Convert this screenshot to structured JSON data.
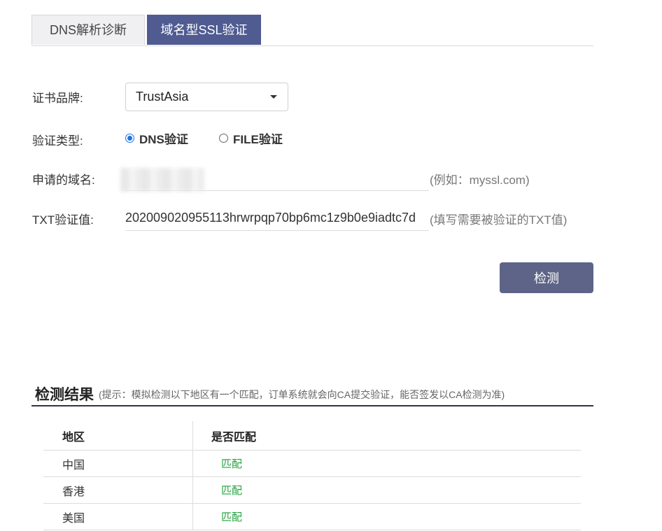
{
  "tabs": [
    {
      "label": "DNS解析诊断",
      "active": false
    },
    {
      "label": "域名型SSL验证",
      "active": true
    }
  ],
  "form": {
    "brand_label": "证书品牌:",
    "brand_value": "TrustAsia",
    "type_label": "验证类型:",
    "type_options": [
      {
        "label": "DNS验证",
        "selected": true
      },
      {
        "label": "FILE验证",
        "selected": false
      }
    ],
    "domain_label": "申请的域名:",
    "domain_value": "",
    "domain_hint": "(例如：myssl.com)",
    "txt_label": "TXT验证值:",
    "txt_value": "202009020955113hrwrpqp70bp6mc1z9b0e9iadtc7d",
    "txt_hint": "(填写需要被验证的TXT值)",
    "check_button": "检测"
  },
  "result": {
    "title": "检测结果",
    "tip": "(提示：模拟检测以下地区有一个匹配，订单系统就会向CA提交验证，能否签发以CA检测为准)",
    "columns": [
      "地区",
      "是否匹配"
    ],
    "rows": [
      {
        "region": "中国",
        "match": "匹配"
      },
      {
        "region": "香港",
        "match": "匹配"
      },
      {
        "region": "美国",
        "match": "匹配"
      }
    ]
  },
  "colors": {
    "tab_active": "#4f5b91",
    "button": "#5d6487",
    "match": "#20a33a"
  }
}
